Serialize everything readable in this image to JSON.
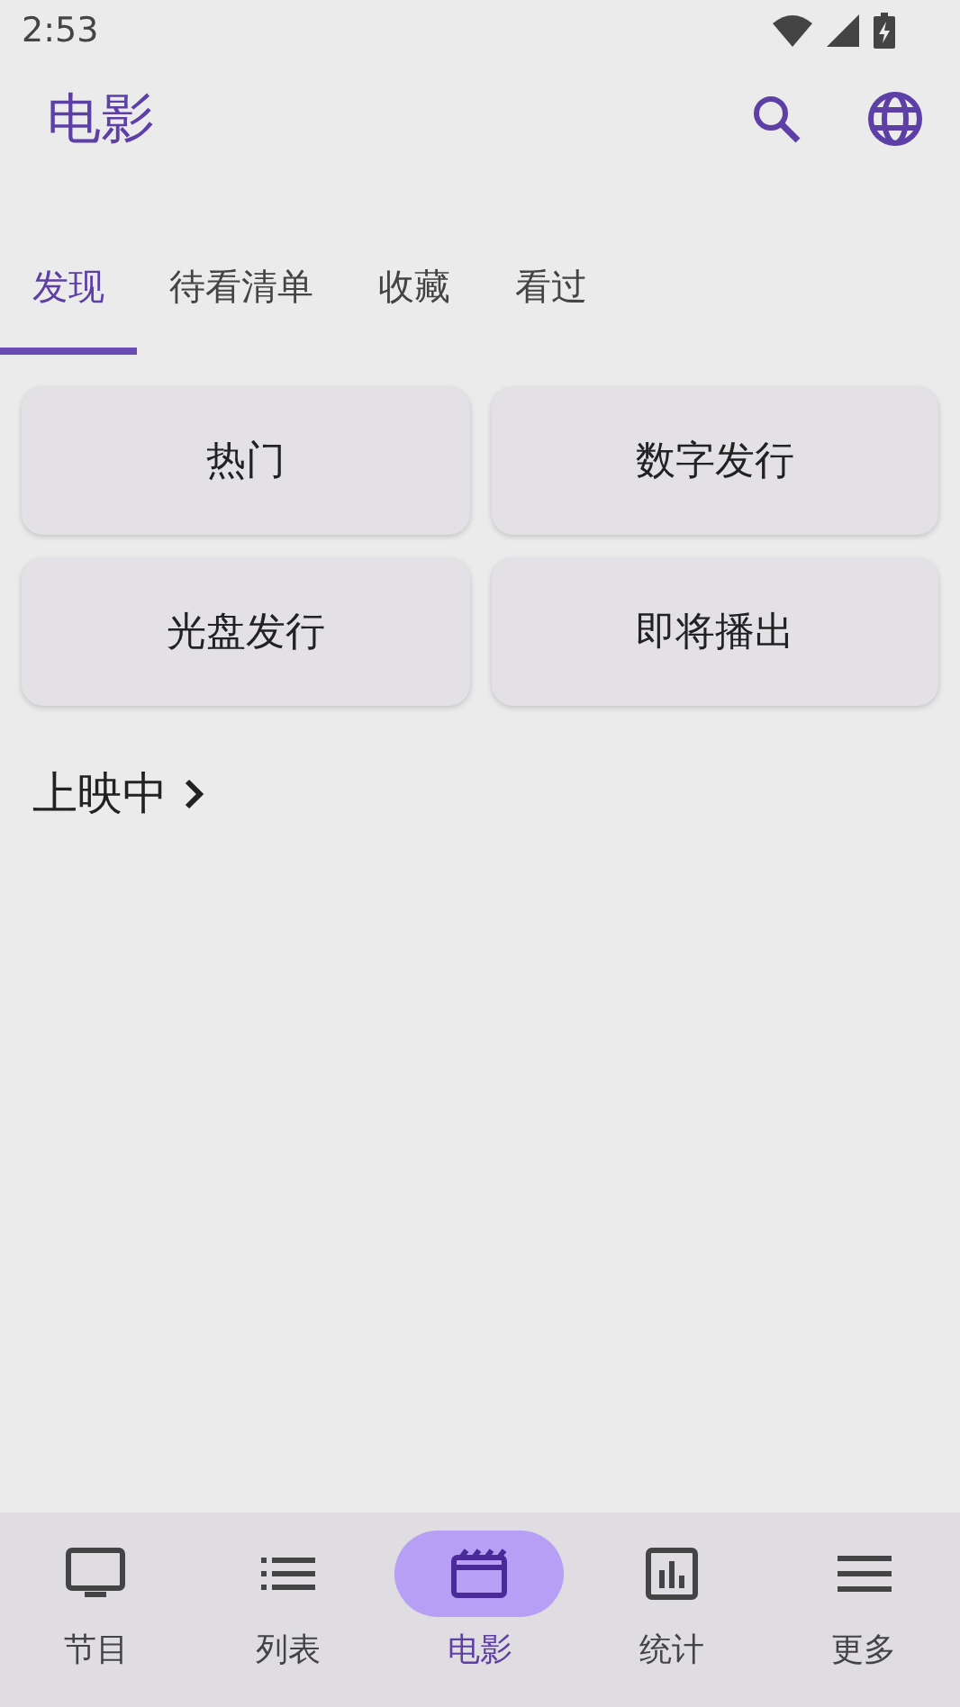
{
  "status_bar": {
    "time": "2:53"
  },
  "app_bar": {
    "title": "电影"
  },
  "tabs": [
    {
      "label": "发现",
      "selected": true
    },
    {
      "label": "待看清单",
      "selected": false
    },
    {
      "label": "收藏",
      "selected": false
    },
    {
      "label": "看过",
      "selected": false
    }
  ],
  "categories": [
    "热门",
    "数字发行",
    "光盘发行",
    "即将播出"
  ],
  "section": {
    "title": "上映中"
  },
  "bottom_nav": [
    {
      "label": "节目",
      "kind": "tv",
      "selected": false
    },
    {
      "label": "列表",
      "kind": "list",
      "selected": false
    },
    {
      "label": "电影",
      "kind": "movie",
      "selected": true
    },
    {
      "label": "统计",
      "kind": "stats",
      "selected": false
    },
    {
      "label": "更多",
      "kind": "more",
      "selected": false
    }
  ]
}
